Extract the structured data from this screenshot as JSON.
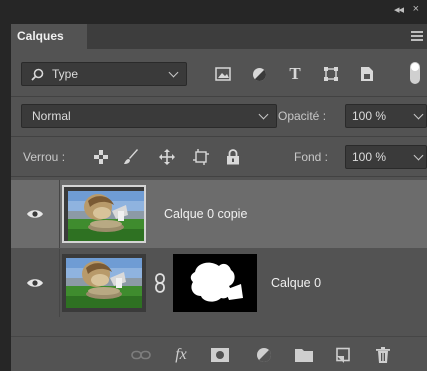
{
  "window": {
    "collapse_glyph": "◂◂",
    "close_glyph": "×"
  },
  "tabs": [
    {
      "label": "Calques"
    }
  ],
  "filter": {
    "kind_label": "Type",
    "icons": [
      "image-filter-icon",
      "adjustment-filter-icon",
      "type-filter-icon",
      "shape-filter-icon",
      "smart-object-filter-icon"
    ],
    "type_icon_glyph": "T"
  },
  "blend": {
    "mode": "Normal"
  },
  "opacity": {
    "label": "Opacité :",
    "value": "100 %"
  },
  "lock": {
    "label": "Verrou :",
    "icons": [
      "lock-transparent-pixels-icon",
      "lock-image-pixels-icon",
      "lock-position-icon",
      "lock-artboard-icon",
      "lock-all-icon"
    ]
  },
  "fill": {
    "label": "Fond :",
    "value": "100 %"
  },
  "layers": [
    {
      "name": "Calque 0 copie",
      "visible": true,
      "selected": true,
      "has_mask": false
    },
    {
      "name": "Calque 0",
      "visible": true,
      "selected": false,
      "has_mask": true
    }
  ],
  "bottom_toolbar": {
    "icons": [
      "link-layers-icon",
      "fx-icon",
      "add-mask-icon",
      "new-adjustment-icon",
      "new-group-icon",
      "new-layer-icon",
      "delete-layer-icon"
    ],
    "fx_label": "fx"
  },
  "colors": {
    "panel": "#535353",
    "header": "#262626",
    "selected_row": "#6c6c6c"
  }
}
